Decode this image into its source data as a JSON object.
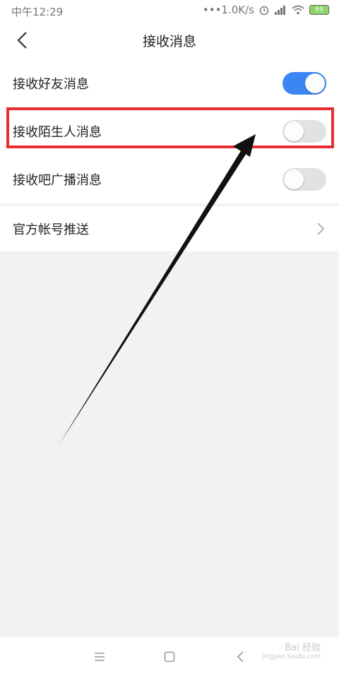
{
  "status_bar": {
    "time": "中午12:29",
    "network_speed": "•••1.0K/s",
    "battery_level": "69"
  },
  "header": {
    "title": "接收消息"
  },
  "settings": [
    {
      "label": "接收好友消息",
      "enabled": true
    },
    {
      "label": "接收陌生人消息",
      "enabled": false
    },
    {
      "label": "接收吧广播消息",
      "enabled": false
    }
  ],
  "official_push": {
    "label": "官方帐号推送"
  },
  "watermark": {
    "brand": "Bai 经验",
    "url": "jingyan.baidu.com"
  },
  "colors": {
    "toggle_on": "#3a87f4",
    "toggle_off": "#e2e2e2",
    "highlight": "#ea2c33",
    "background": "#f2f2f2"
  }
}
